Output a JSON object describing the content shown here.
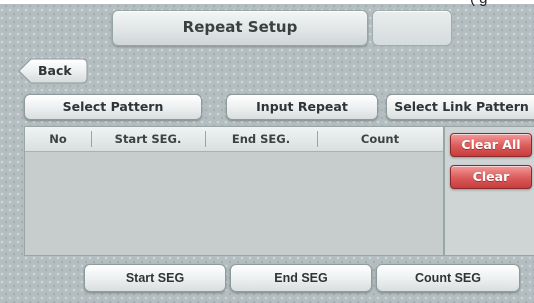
{
  "top_cutoff_text": "(        g",
  "header": {
    "title": "Repeat Setup"
  },
  "nav": {
    "back_label": "Back"
  },
  "toolbar": {
    "select_pattern_label": "Select Pattern",
    "input_repeat_label": "Input Repeat",
    "select_link_pattern_label": "Select Link Pattern"
  },
  "table": {
    "columns": [
      "No",
      "Start SEG.",
      "End SEG.",
      "Count"
    ],
    "rows": []
  },
  "side_actions": {
    "clear_all_label": "Clear All",
    "clear_label": "Clear"
  },
  "bottom_bar": {
    "start_seg_label": "Start SEG",
    "end_seg_label": "End SEG",
    "count_seg_label": "Count SEG"
  },
  "colors": {
    "background": "#b4bec0",
    "danger_button": "#db5a5a",
    "button_face": "#eef1f1",
    "table_body": "#c7cdcd"
  }
}
